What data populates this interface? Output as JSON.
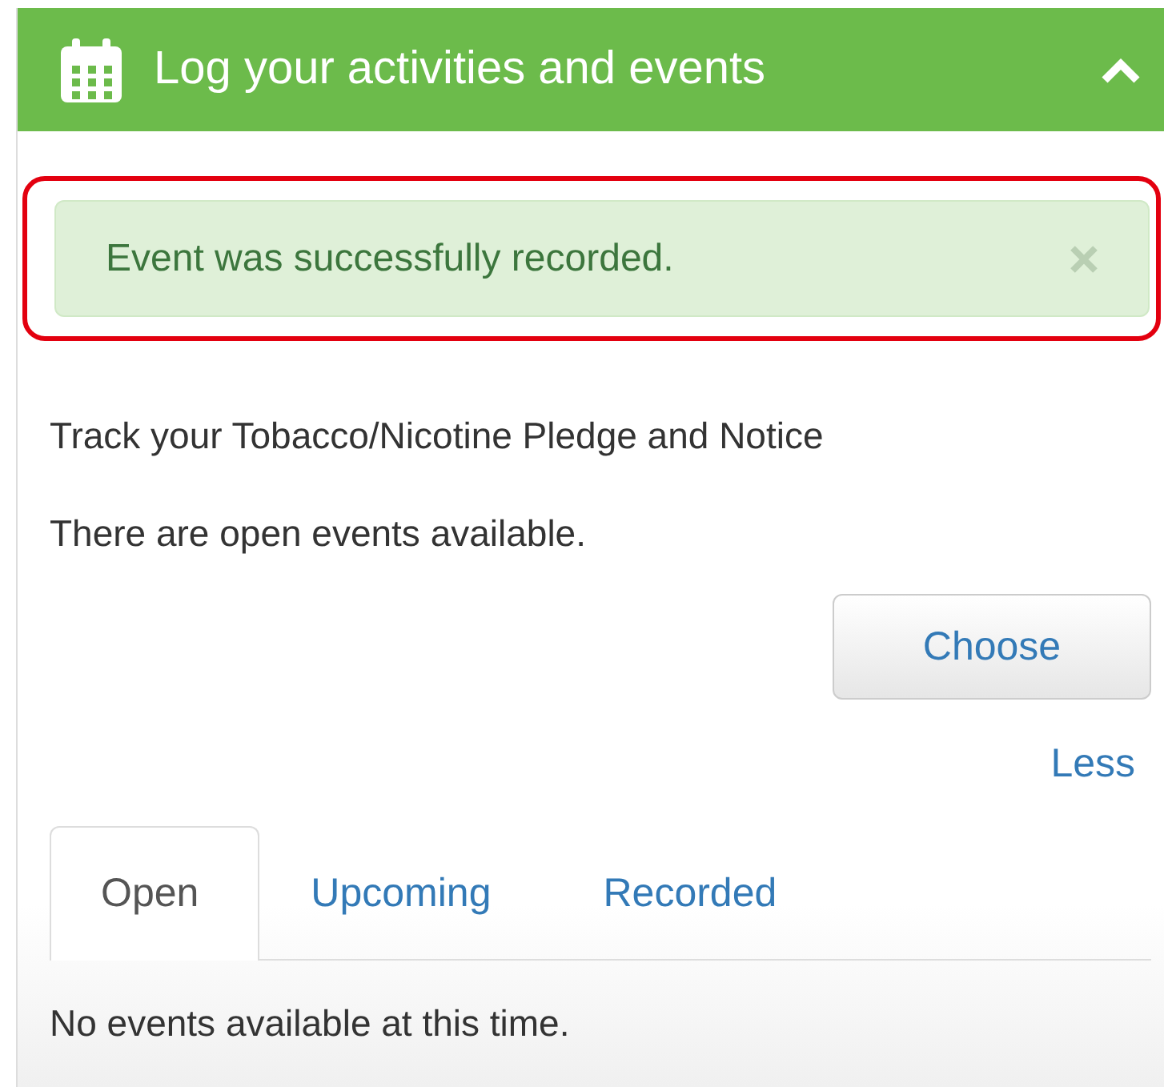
{
  "panel": {
    "title": "Log your activities and events",
    "expanded": true
  },
  "alert": {
    "message": "Event was successfully recorded.",
    "highlighted": true
  },
  "texts": [
    "Track your Tobacco/Nicotine Pledge and Notice",
    "There are open events available."
  ],
  "choose_button": "Choose",
  "less_link": "Less",
  "tabs": [
    {
      "label": "Open",
      "selected": true
    },
    {
      "label": "Upcoming",
      "selected": false
    },
    {
      "label": "Recorded",
      "selected": false
    }
  ],
  "tab_content": "No events available at this time."
}
